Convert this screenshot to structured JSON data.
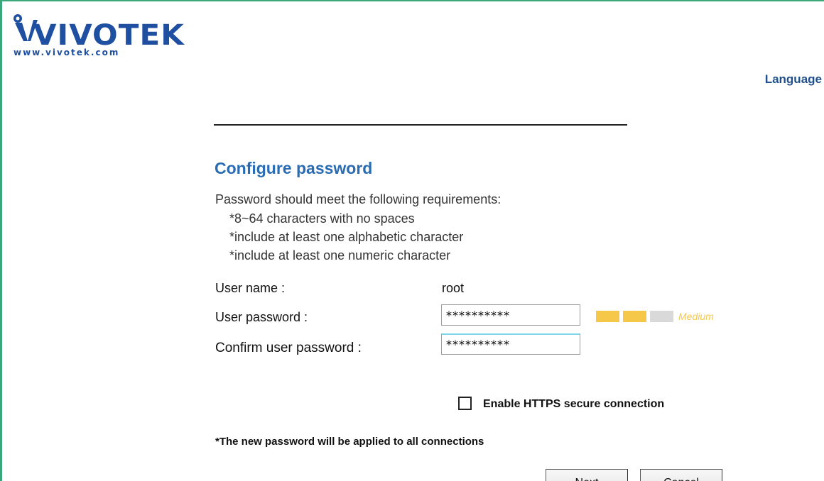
{
  "brand": {
    "name": "VIVOTEK",
    "url": "www.vivotek.com",
    "color": "#1f4fa0"
  },
  "header": {
    "language_link": "Language"
  },
  "form": {
    "title": "Configure password",
    "requirements_intro": "Password should meet the following requirements:",
    "requirements": [
      "*8~64 characters with no spaces",
      "*include at least one alphabetic character",
      "*include at least one numeric character"
    ],
    "username_label": "User name :",
    "username_value": "root",
    "password_label": "User password :",
    "password_value": "**********",
    "confirm_label": "Confirm user password :",
    "confirm_value": "**********",
    "strength": {
      "label": "Medium",
      "filled_segments": 2,
      "total_segments": 3,
      "filled_color": "#f5c84a",
      "empty_color": "#d9d9d9"
    },
    "https_checkbox_label": "Enable HTTPS secure connection",
    "https_checked": false,
    "note": "*The new password will be applied to all connections",
    "next_button": "Next",
    "cancel_button": "Cancel"
  },
  "colors": {
    "title": "#2a6cb3",
    "frame_border": "#3aa87a",
    "link": "#1f4f8c"
  }
}
